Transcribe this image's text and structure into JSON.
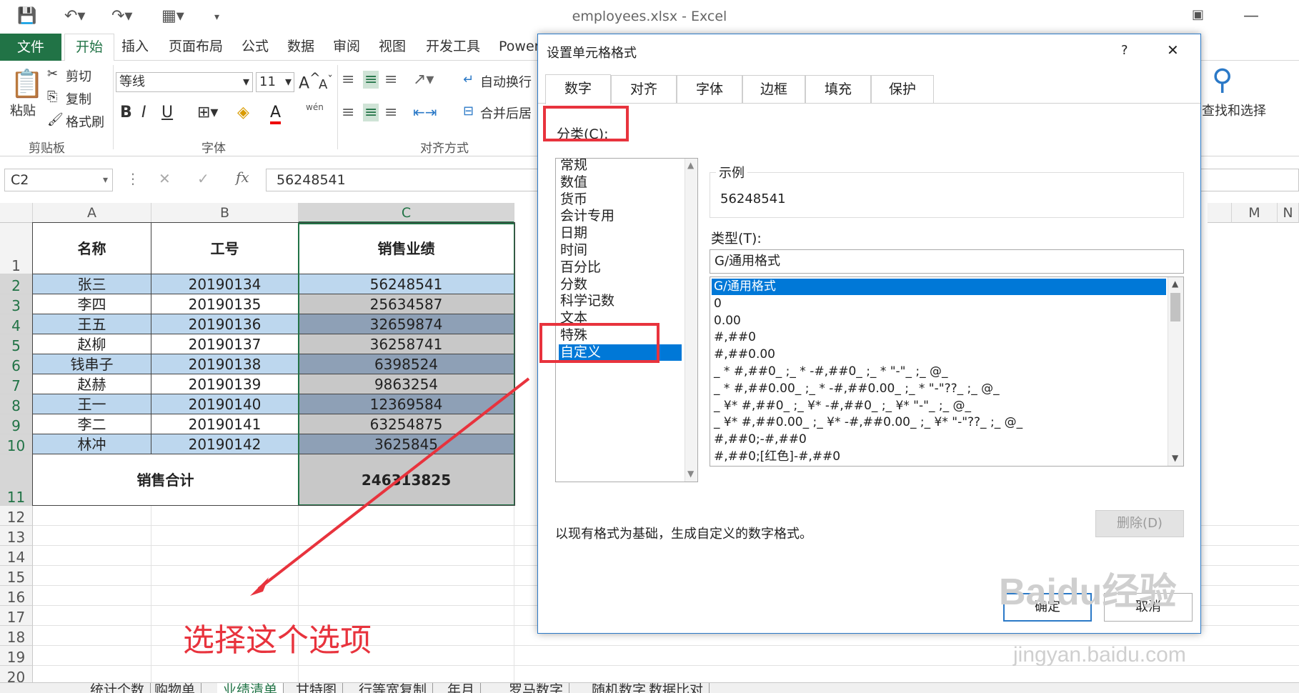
{
  "window": {
    "title": "employees.xlsx - Excel"
  },
  "ribbon": {
    "tabs": [
      "文件",
      "开始",
      "插入",
      "页面布局",
      "公式",
      "数据",
      "审阅",
      "视图",
      "开发工具",
      "Power"
    ],
    "clipboard": {
      "paste": "粘贴",
      "cut": "剪切",
      "copy": "复制",
      "format_painter": "格式刷",
      "group": "剪贴板"
    },
    "font": {
      "name": "等线",
      "size": "11",
      "bold": "B",
      "italic": "I",
      "underline": "U",
      "font_color": "A",
      "phonetic": "wén",
      "group": "字体"
    },
    "alignment": {
      "wrap": "自动换行",
      "merge": "合并后居",
      "group": "对齐方式"
    },
    "editing": {
      "find_select": "查找和选择"
    }
  },
  "formula_bar": {
    "name_box": "C2",
    "fx": "fx",
    "value": "56248541"
  },
  "grid": {
    "columns": [
      "A",
      "B",
      "C"
    ],
    "right_columns": [
      "M",
      "N"
    ],
    "header_row": [
      "名称",
      "工号",
      "销售业绩"
    ],
    "rows": [
      [
        "张三",
        "20190134",
        "56248541"
      ],
      [
        "李四",
        "20190135",
        "25634587"
      ],
      [
        "王五",
        "20190136",
        "32659874"
      ],
      [
        "赵柳",
        "20190137",
        "36258741"
      ],
      [
        "钱串子",
        "20190138",
        "6398524"
      ],
      [
        "赵赫",
        "20190139",
        "9863254"
      ],
      [
        "王一",
        "20190140",
        "12369584"
      ],
      [
        "李二",
        "20190141",
        "63254875"
      ],
      [
        "林冲",
        "20190142",
        "3625845"
      ]
    ],
    "total_label": "销售合计",
    "total_value": "246313825",
    "row_numbers": [
      "1",
      "2",
      "3",
      "4",
      "5",
      "6",
      "7",
      "8",
      "9",
      "10",
      "11",
      "12",
      "13",
      "14",
      "15",
      "16",
      "17",
      "18",
      "19",
      "20"
    ]
  },
  "sheet_tabs": [
    "统计个数",
    "购物单",
    "业绩清单",
    "甘特图",
    "行等宽复制",
    "年月",
    "罗马数字",
    "随机数字",
    "数据比对"
  ],
  "annotation": {
    "text": "选择这个选项",
    "color": "#e8333d"
  },
  "dialog": {
    "title": "设置单元格格式",
    "help": "?",
    "close": "✕",
    "tabs": [
      "数字",
      "对齐",
      "字体",
      "边框",
      "填充",
      "保护"
    ],
    "category_label": "分类(C):",
    "categories": [
      "常规",
      "数值",
      "货币",
      "会计专用",
      "日期",
      "时间",
      "百分比",
      "分数",
      "科学记数",
      "文本",
      "特殊",
      "自定义"
    ],
    "selected_category": "自定义",
    "sample_label": "示例",
    "sample_value": "56248541",
    "type_label": "类型(T):",
    "type_value": "G/通用格式",
    "formats": [
      "G/通用格式",
      "0",
      "0.00",
      "#,##0",
      "#,##0.00",
      "_ * #,##0_ ;_ * -#,##0_ ;_ * \"-\"_ ;_ @_",
      "_ * #,##0.00_ ;_ * -#,##0.00_ ;_ * \"-\"??_ ;_ @_",
      "_ ¥* #,##0_ ;_ ¥* -#,##0_ ;_ ¥* \"-\"_ ;_ @_",
      "_ ¥* #,##0.00_ ;_ ¥* -#,##0.00_ ;_ ¥* \"-\"??_ ;_ @_",
      "#,##0;-#,##0",
      "#,##0;[红色]-#,##0"
    ],
    "delete_button": "删除(D)",
    "description": "以现有格式为基础，生成自定义的数字格式。",
    "ok": "确定",
    "cancel": "取消"
  },
  "watermark": {
    "brand": "Baidu经验",
    "url": "jingyan.baidu.com"
  },
  "colors": {
    "excel_green": "#217346",
    "row_blue": "#bdd7ee",
    "row_gray": "#c8c8c8",
    "row_slate": "#8ea0b6",
    "selection_blue": "#0078d7"
  }
}
